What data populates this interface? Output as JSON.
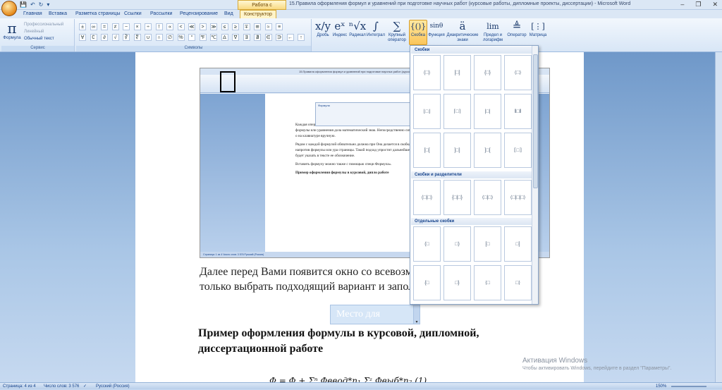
{
  "window": {
    "title": "15.Правила оформления формул и уравнений при подготовке научных работ (курсовые работы, дипломные проекты, диссертации) - Microsoft Word",
    "context_tab": "Работа с формулами",
    "controls": [
      "–",
      "❐",
      "✕"
    ]
  },
  "tabs": [
    "Главная",
    "Вставка",
    "Разметка страницы",
    "Ссылки",
    "Рассылки",
    "Рецензирование",
    "Вид",
    "Конструктор"
  ],
  "ribbon": {
    "service": {
      "formula_glyph": "π",
      "formula_label": "Формула",
      "options": [
        "Профессиональный",
        "Линейный",
        "Обычный текст"
      ],
      "group_label": "Сервис"
    },
    "symbols": {
      "row1": [
        "±",
        "∞",
        "=",
        "≠",
        "~",
        "×",
        "÷",
        "!",
        "∝",
        "<",
        "≪",
        ">",
        "≫",
        "≤",
        "≥",
        "∓",
        "≅",
        "≈",
        "≡"
      ],
      "row2": [
        "∀",
        "∁",
        "∂",
        "√",
        "∛",
        "∜",
        "∪",
        "∩",
        "∅",
        "%",
        "°",
        "℉",
        "℃",
        "∆",
        "∇",
        "∃",
        "∄",
        "∈",
        "∋",
        "←",
        "↑"
      ],
      "group_label": "Символы"
    },
    "structures": [
      {
        "glyph": "x/y",
        "label": "Дробь"
      },
      {
        "glyph": "eˣ",
        "label": "Индекс"
      },
      {
        "glyph": "ⁿ√x",
        "label": "Радикал"
      },
      {
        "glyph": "∫",
        "label": "Интеграл"
      },
      {
        "glyph": "∑",
        "label": "Крупный оператор"
      },
      {
        "glyph": "{()}",
        "label": "Скобка"
      },
      {
        "glyph": "sinθ",
        "label": "Функция"
      },
      {
        "glyph": "ä",
        "label": "Диакритические знаки"
      },
      {
        "glyph": "lim",
        "label": "Предел и логарифм"
      },
      {
        "glyph": "≜",
        "label": "Оператор"
      },
      {
        "glyph": "[⋮]",
        "label": "Матрица"
      }
    ]
  },
  "dropdown": {
    "sections": [
      {
        "title": "Скобки",
        "cells": [
          "(□)",
          "[□]",
          "{□}",
          "⟨□⟩",
          "⌊□⌋",
          "⌈□⌉",
          "|□|",
          "‖□‖",
          "[□[",
          "]□]",
          "]□[",
          "⟦□⟧"
        ]
      },
      {
        "title": "Скобки и разделители",
        "cells": [
          "(□|□)",
          "{□|□}",
          "⟨□|□⟩",
          "⟨□|□|□⟩"
        ]
      },
      {
        "title": "Отдельные скобки",
        "cells": [
          "(□",
          "□)",
          "[□",
          "□]",
          "{□",
          "□}",
          "⟨□",
          "□⟩"
        ]
      }
    ]
  },
  "document": {
    "screenshot": {
      "title": "15.Правила оформления формул и уравнений при подготовке научных работ (курсовые работы, дипломные проекты, диссертации) - Microsoft Word",
      "float_label": "Формула",
      "paragraphs": [
        "Каждая операция будет оформляться с мощью дин составным элементом формулы или уравнения дола математический знак. Непосредственно символы, о на клавиатуре вручную.",
        "Рядом с каждой формулой обязательно должна при Она делается в скобках напротив формулы или ура страницы. Такой подход упростит дальнейшее упом будет указать в тексте ее обозначение.",
        "Вставить формулу можно также с помощью специ Формула».",
        "Пример оформления формулы в курсовой, дипло работе"
      ],
      "status": "Страница: 1 из 4   Число слов: 3 576   Русский (Россия)"
    },
    "line1": "Далее перед Вами появится окно со всевозможн",
    "line2": "только выбрать подходящий вариант и заполни",
    "placeholder": "Место для формулы.",
    "heading": "Пример оформления формулы в курсовой, дипломной, диссертационной работе",
    "formula_preview": "Ф    = Ф     + Σⁿ  Фввод*n₁      Σᶻ  Фвыб*n₂        (1)"
  },
  "watermark": {
    "title": "Активация Windows",
    "subtitle": "Чтобы активировать Windows, перейдите в раздел \"Параметры\"."
  },
  "status": {
    "page": "Страница: 4 из 4",
    "words": "Число слов: 3 576",
    "lang": "Русский (Россия)",
    "zoom": "150%"
  }
}
